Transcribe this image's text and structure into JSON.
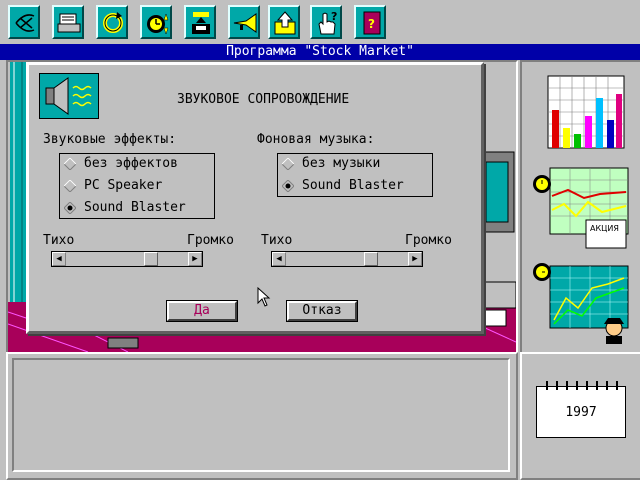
{
  "window": {
    "title": "Программа \"Stock Market\""
  },
  "toolbar": {
    "tools": [
      {
        "icon": "dollar-logo-icon"
      },
      {
        "icon": "printer-icon"
      },
      {
        "icon": "refresh-icon"
      },
      {
        "icon": "clock-icon"
      },
      {
        "icon": "save-disk-icon"
      },
      {
        "icon": "trumpet-icon"
      },
      {
        "icon": "export-icon"
      },
      {
        "icon": "help-hand-icon"
      },
      {
        "icon": "book-icon"
      }
    ]
  },
  "dialog": {
    "title": "ЗВУКОВОЕ СОПРОВОЖДЕНИЕ",
    "effects": {
      "label": "Звуковые эффекты:",
      "options": [
        "без эффектов",
        "PC Speaker",
        "Sound Blaster"
      ],
      "selected_index": 2,
      "volume": {
        "min_label": "Тихо",
        "max_label": "Громко",
        "level": 0.72
      }
    },
    "music": {
      "label": "Фоновая музыка:",
      "options": [
        "без музыки",
        "Sound Blaster"
      ],
      "selected_index": 1,
      "volume": {
        "min_label": "Тихо",
        "max_label": "Громко",
        "level": 0.72
      }
    },
    "ok_label": "Да",
    "cancel_label": "Отказ"
  },
  "side_panel": {
    "stock_badge": "АКЦИЯ",
    "calendar_year": "1997"
  },
  "colors": {
    "titlebar": "#0000a8",
    "toolbar_tile": "#00a8a8",
    "ok_text": "#a8005a"
  }
}
